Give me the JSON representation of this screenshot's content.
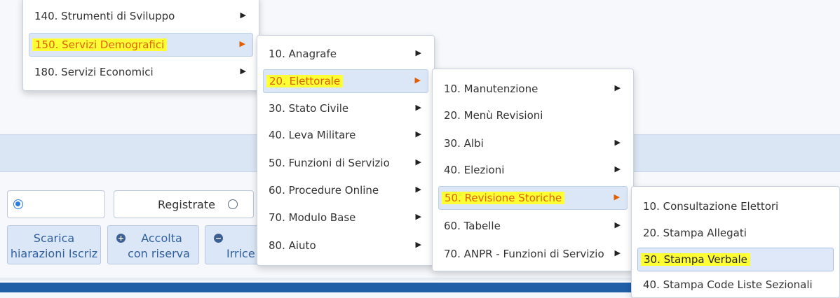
{
  "menus": {
    "level1": [
      {
        "label": "140. Strumenti di Sviluppo",
        "submenu": true
      },
      {
        "label": "150. Servizi Demografici",
        "submenu": true,
        "selected": true
      },
      {
        "label": "180. Servizi Economici",
        "submenu": true
      }
    ],
    "level2": [
      {
        "label": "10. Anagrafe",
        "submenu": true
      },
      {
        "label": "20. Elettorale",
        "submenu": true,
        "selected": true
      },
      {
        "label": "30. Stato Civile",
        "submenu": true
      },
      {
        "label": "40. Leva Militare",
        "submenu": true
      },
      {
        "label": "50. Funzioni di Servizio",
        "submenu": true
      },
      {
        "label": "60. Procedure Online",
        "submenu": true
      },
      {
        "label": "70. Modulo Base",
        "submenu": true
      },
      {
        "label": "80. Aiuto",
        "submenu": true
      }
    ],
    "level3": [
      {
        "label": "10. Manutenzione",
        "submenu": true
      },
      {
        "label": "20. Menù Revisioni",
        "submenu": false
      },
      {
        "label": "30. Albi",
        "submenu": true
      },
      {
        "label": "40. Elezioni",
        "submenu": true
      },
      {
        "label": "50. Revisione Storiche",
        "submenu": true,
        "selected": true
      },
      {
        "label": "60. Tabelle",
        "submenu": true
      },
      {
        "label": "70. ANPR - Funzioni di Servizio",
        "submenu": true
      }
    ],
    "level4": [
      {
        "label": "10. Consultazione Elettori",
        "submenu": false
      },
      {
        "label": "20. Stampa Allegati",
        "submenu": false
      },
      {
        "label": "30. Stampa Verbale",
        "submenu": false,
        "highlighted": true
      },
      {
        "label": "40. Stampa Code Liste Sezionali",
        "submenu": false
      }
    ]
  },
  "form": {
    "radio_registrate_label": "Registrate"
  },
  "toolbar": {
    "scarica_l1": "Scarica",
    "scarica_l2": "hiarazioni Iscriz",
    "accolta_l1": "Accolta",
    "accolta_l2": "con riserva",
    "irrice_l2": "Irrice",
    "plus_icon": "+",
    "minus_icon": "−"
  },
  "colors": {
    "highlight": "#ffff33",
    "selected_text": "#e06000",
    "accent": "#1f5fa8"
  }
}
